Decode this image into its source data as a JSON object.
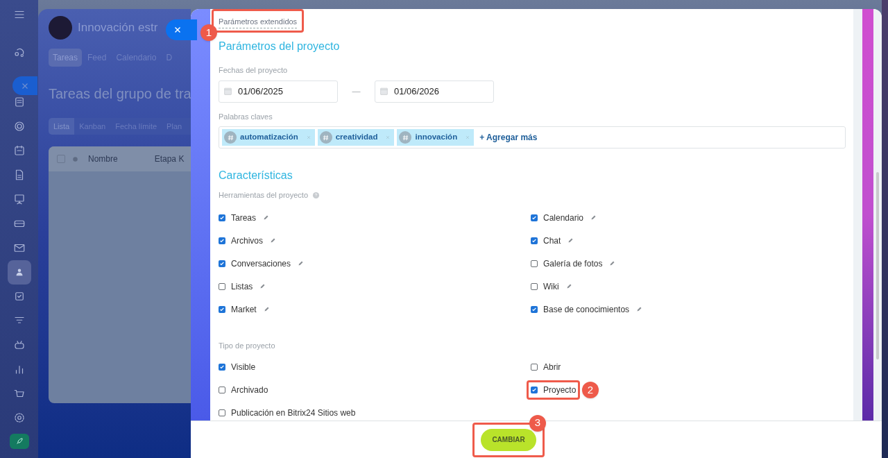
{
  "background_page": {
    "title": "Innovación estr",
    "tabs": [
      {
        "label": "Tareas",
        "selected": true
      },
      {
        "label": "Feed",
        "selected": false
      },
      {
        "label": "Calendario",
        "selected": false
      },
      {
        "label": "D",
        "selected": false
      }
    ],
    "heading": "Tareas del grupo de tra",
    "view_tabs": [
      {
        "label": "Lista",
        "selected": true
      },
      {
        "label": "Kanban",
        "selected": false
      },
      {
        "label": "Fecha límite",
        "selected": false
      },
      {
        "label": "Plan",
        "selected": false
      }
    ],
    "select_all": {
      "checked": false
    },
    "table_columns": [
      "Nombre",
      "Etapa K"
    ]
  },
  "form": {
    "extended_link": {
      "text": "Parámetros extendidos",
      "callout": "1"
    },
    "section_title": "Parámetros del proyecto",
    "dates": {
      "label": "Fechas del proyecto",
      "start": "01/06/2025",
      "separator": "—",
      "end": "01/06/2026"
    },
    "keywords": {
      "label": "Palabras claves",
      "tags": [
        "automatización",
        "creatividad",
        "innovación"
      ],
      "add": "+ Agregar más"
    },
    "features_title": "Características",
    "tools": {
      "label": "Herramientas del proyecto",
      "items": [
        {
          "label": "Tareas",
          "checked": true
        },
        {
          "label": "Calendario",
          "checked": true
        },
        {
          "label": "Archivos",
          "checked": true
        },
        {
          "label": "Chat",
          "checked": true
        },
        {
          "label": "Conversaciones",
          "checked": true
        },
        {
          "label": "Galería de fotos",
          "checked": false
        },
        {
          "label": "Listas",
          "checked": false
        },
        {
          "label": "Wiki",
          "checked": false
        },
        {
          "label": "Market",
          "checked": true
        },
        {
          "label": "Base de conocimientos",
          "checked": true
        }
      ]
    },
    "project_type": {
      "label": "Tipo de proyecto",
      "items": [
        {
          "label": "Visible",
          "checked": true
        },
        {
          "label": "Abrir",
          "checked": false
        },
        {
          "label": "Archivado",
          "checked": false
        },
        {
          "label": "Proyecto",
          "checked": true,
          "callout": "2"
        },
        {
          "label": "Publicación en Bitrix24 Sitios web",
          "checked": false
        }
      ]
    }
  },
  "footer": {
    "button": {
      "label": "CAMBIAR",
      "callout": "3"
    }
  }
}
